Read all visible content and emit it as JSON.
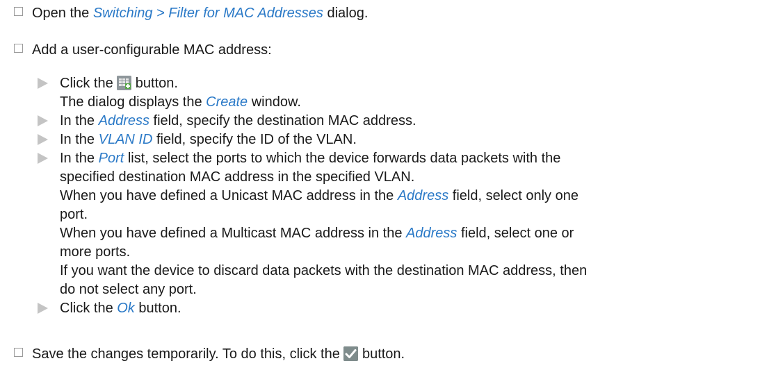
{
  "steps": [
    {
      "pre": "Open the ",
      "link": "Switching > Filter for MAC Addresses",
      "post": " dialog."
    },
    {
      "text": "Add a user-configurable MAC address:"
    }
  ],
  "substeps": {
    "click_create": {
      "pre": "Click the ",
      "post": " button.",
      "line2_pre": "The dialog displays the ",
      "line2_link": "Create",
      "line2_post": " window."
    },
    "address": {
      "pre": "In the ",
      "link": "Address",
      "post": " field, specify the destination MAC address."
    },
    "vlan": {
      "pre": "In the ",
      "link": "VLAN ID",
      "post": " field, specify the ID of the VLAN."
    },
    "port": {
      "l1_pre": "In the ",
      "l1_link": "Port",
      "l1_post": " list, select the ports to which the device forwards data packets with the",
      "l2": "specified destination MAC address in the specified VLAN.",
      "l3_pre": "When you have defined a Unicast MAC address in the ",
      "l3_link": "Address",
      "l3_post": " field, select only one",
      "l4": "port.",
      "l5_pre": "When you have defined a Multicast MAC address in the ",
      "l5_link": "Address",
      "l5_post": " field, select one or",
      "l6": "more ports.",
      "l7": "If you want the device to discard data packets with the destination MAC address, then",
      "l8": "do not select any port."
    },
    "ok": {
      "pre": "Click the ",
      "link": "Ok",
      "post": " button."
    }
  },
  "save": {
    "pre": "Save the changes temporarily. To do this, click the ",
    "post": " button."
  },
  "icons": {
    "create": "create-table-row-icon",
    "save": "checkmark-save-icon"
  },
  "colors": {
    "link": "#2a79c7",
    "arrow": "#c4c4c4",
    "checkbox_border": "#9a9a9a"
  }
}
